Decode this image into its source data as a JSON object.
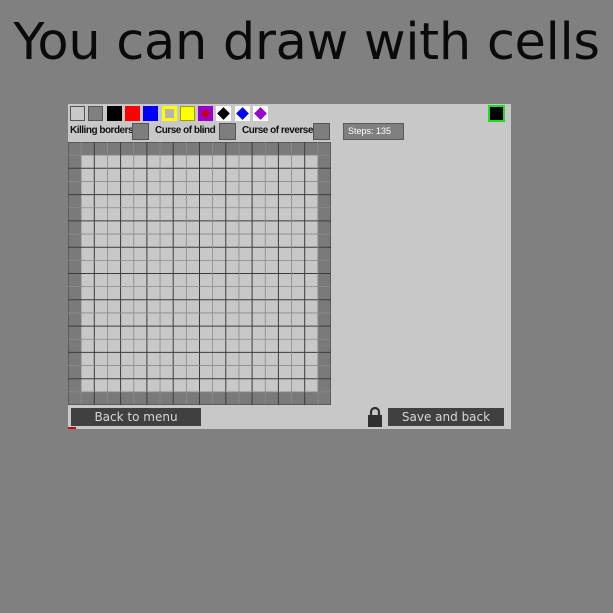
{
  "headline": "You can draw with cells",
  "palette": [
    {
      "name": "swatch-light-gray",
      "color": "#c8c8c8",
      "style": "outlined"
    },
    {
      "name": "swatch-gray",
      "color": "#808080",
      "style": "outlined"
    },
    {
      "name": "swatch-black",
      "color": "#000000",
      "style": "plain"
    },
    {
      "name": "swatch-red",
      "color": "#ff0000",
      "style": "plain"
    },
    {
      "name": "swatch-blue",
      "color": "#0000ff",
      "style": "plain"
    },
    {
      "name": "swatch-yellow-gray",
      "color": "#ffff00",
      "style": "yellow-gray"
    },
    {
      "name": "swatch-yellow",
      "color": "#ffff00",
      "style": "yellow"
    },
    {
      "name": "swatch-purple-red-dot",
      "color": "#9900cc",
      "style": "dot"
    },
    {
      "name": "swatch-black-diamond",
      "color": "#000000",
      "style": "diamond"
    },
    {
      "name": "swatch-blue-diamond",
      "color": "#0000ff",
      "style": "diamond"
    },
    {
      "name": "swatch-purple-diamond",
      "color": "#9900cc",
      "style": "diamond"
    }
  ],
  "current_color": "#000000",
  "options": {
    "killing_borders": "Killing borders",
    "curse_of_blind": "Curse of blind",
    "curse_of_reverse": "Curse of reverse"
  },
  "steps_label": "Steps: 135",
  "grid": {
    "cells": 20,
    "border_color": "#7a7a7a",
    "inner_color": "#c8c8c8"
  },
  "buttons": {
    "back": "Back to menu",
    "save": "Save and back"
  }
}
